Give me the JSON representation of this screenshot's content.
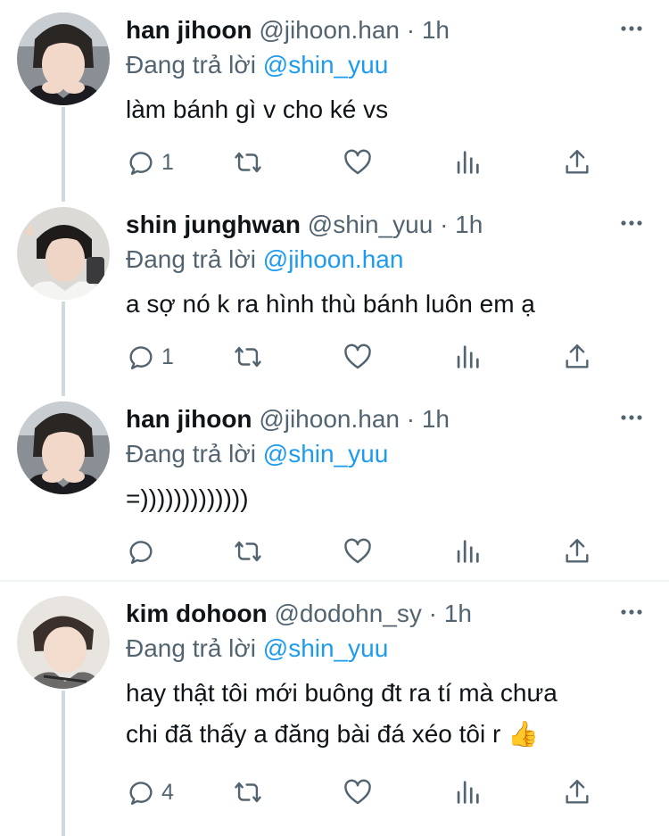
{
  "tweets": [
    {
      "display_name": "han jihoon",
      "handle": "@jihoon.han",
      "time": "· 1h",
      "reply_prefix": "Đang trả lời",
      "reply_to": "@shin_yuu",
      "text": "làm bánh gì v cho ké vs",
      "reply_count": "1"
    },
    {
      "display_name": "shin junghwan",
      "handle": "@shin_yuu",
      "time": "· 1h",
      "reply_prefix": "Đang trả lời",
      "reply_to": "@jihoon.han",
      "text": "a sợ nó k ra hình thù bánh luôn em ạ",
      "reply_count": "1"
    },
    {
      "display_name": "han jihoon",
      "handle": "@jihoon.han",
      "time": "· 1h",
      "reply_prefix": "Đang trả lời",
      "reply_to": "@shin_yuu",
      "text": "=)))))))))))))",
      "reply_count": ""
    },
    {
      "display_name": "kim dohoon",
      "handle": "@dodohn_sy",
      "time": "· 1h",
      "reply_prefix": "Đang trả lời",
      "reply_to": "@shin_yuu",
      "text_line1": "hay thật tôi mới buông đt ra tí mà chưa",
      "text_line2": "chi đã thấy a đăng bài đá xéo tôi r",
      "emoji": "👍",
      "reply_count": "4"
    }
  ],
  "icons": {
    "reply": "reply-icon",
    "retweet": "retweet-icon",
    "like": "heart-icon",
    "views": "views-icon",
    "share": "share-icon",
    "more": "more-icon"
  },
  "colors": {
    "accent": "#1d9bf0",
    "secondary_text": "#536471",
    "thread_line": "#cfd9de"
  }
}
